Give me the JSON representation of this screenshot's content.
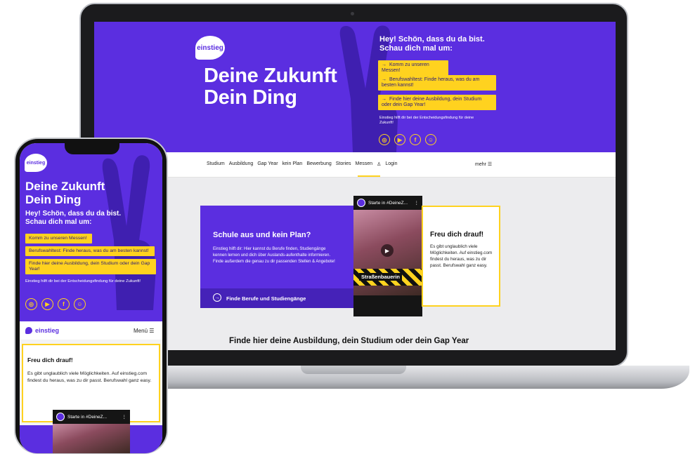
{
  "brand": {
    "logo": "einstieg",
    "purple": "#5b2ee0",
    "yellow": "#ffd21f"
  },
  "laptop": {
    "hero": {
      "headline_1": "Deine Zukunft",
      "headline_2": "Dein Ding",
      "greeting_1": "Hey! Schön, dass du da bist.",
      "greeting_2": "Schau dich mal um:",
      "cta_1": "Komm zu unseren Messen!",
      "cta_2": "Berufswahltest: Finde heraus, was du am besten kannst!",
      "cta_3": "Finde hier deine Ausbildung, dein Studium oder dein Gap Year!",
      "help": "Einstieg hilft dir bei der Entscheidungsfindung für deine Zukunft!",
      "socials": [
        "instagram-icon",
        "youtube-icon",
        "facebook-icon",
        "snapchat-icon"
      ]
    },
    "nav": {
      "items": [
        "Studium",
        "Ausbildung",
        "Gap Year",
        "kein Plan",
        "Bewerbung",
        "Stories",
        "Messen",
        "Login"
      ],
      "more": "mehr"
    },
    "card": {
      "title": "Schule aus und kein Plan?",
      "text": "Einstieg hilft dir: Hier kannst du Berufe finden, Studiengänge kennen lernen und dich über Auslands-aufenthalte informieren. Finde außerdem die genau zu dir passenden Stellen & Angebote!",
      "link": "Finde Berufe und Studiengänge"
    },
    "video": {
      "title": "Starte in #DeineZ...",
      "label": "Straßenbauerin"
    },
    "freu": {
      "title": "Freu dich drauf!",
      "text": "Es gibt unglaublich viele Möglichkeiten. Auf einstieg.com findest du heraus, was zu dir passt. Berufswahl ganz easy."
    },
    "bottom_heading": "Finde hier deine Ausbildung, dein Studium oder dein Gap Year"
  },
  "phone": {
    "hero": {
      "headline_1": "Deine Zukunft",
      "headline_2": "Dein Ding",
      "greeting_1": "Hey! Schön, dass du da bist.",
      "greeting_2": "Schau dich mal um:",
      "cta_1": "Komm zu unseren Messen!",
      "cta_2": "Berufswahltest: Finde heraus, was du am besten kannst!",
      "cta_3": "Finde hier deine Ausbildung, dein Studium oder dein Gap Year!",
      "help": "Einstieg hilft dir bei der Entscheidungsfindung für deine Zukunft!"
    },
    "nav": {
      "brand": "einstieg",
      "menu": "Menü"
    },
    "freu": {
      "title": "Freu dich drauf!",
      "text": "Es gibt unglaublich viele Möglichkeiten. Auf einstieg.com findest du heraus, was zu dir passt. Berufswahl ganz easy."
    },
    "video": {
      "title": "Starte in #DeineZ..."
    }
  }
}
